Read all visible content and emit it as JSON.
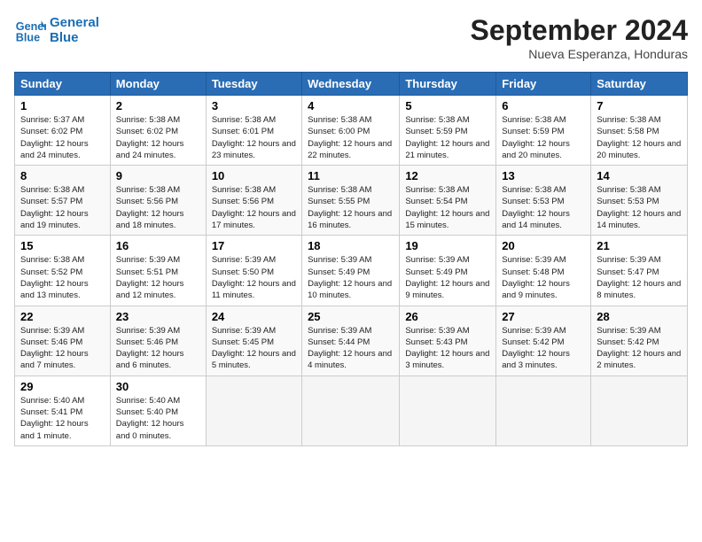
{
  "header": {
    "logo_line1": "General",
    "logo_line2": "Blue",
    "month": "September 2024",
    "location": "Nueva Esperanza, Honduras"
  },
  "columns": [
    "Sunday",
    "Monday",
    "Tuesday",
    "Wednesday",
    "Thursday",
    "Friday",
    "Saturday"
  ],
  "weeks": [
    [
      {
        "day": "1",
        "sunrise": "5:37 AM",
        "sunset": "6:02 PM",
        "daylight": "12 hours and 24 minutes."
      },
      {
        "day": "2",
        "sunrise": "5:38 AM",
        "sunset": "6:02 PM",
        "daylight": "12 hours and 24 minutes."
      },
      {
        "day": "3",
        "sunrise": "5:38 AM",
        "sunset": "6:01 PM",
        "daylight": "12 hours and 23 minutes."
      },
      {
        "day": "4",
        "sunrise": "5:38 AM",
        "sunset": "6:00 PM",
        "daylight": "12 hours and 22 minutes."
      },
      {
        "day": "5",
        "sunrise": "5:38 AM",
        "sunset": "5:59 PM",
        "daylight": "12 hours and 21 minutes."
      },
      {
        "day": "6",
        "sunrise": "5:38 AM",
        "sunset": "5:59 PM",
        "daylight": "12 hours and 20 minutes."
      },
      {
        "day": "7",
        "sunrise": "5:38 AM",
        "sunset": "5:58 PM",
        "daylight": "12 hours and 20 minutes."
      }
    ],
    [
      {
        "day": "8",
        "sunrise": "5:38 AM",
        "sunset": "5:57 PM",
        "daylight": "12 hours and 19 minutes."
      },
      {
        "day": "9",
        "sunrise": "5:38 AM",
        "sunset": "5:56 PM",
        "daylight": "12 hours and 18 minutes."
      },
      {
        "day": "10",
        "sunrise": "5:38 AM",
        "sunset": "5:56 PM",
        "daylight": "12 hours and 17 minutes."
      },
      {
        "day": "11",
        "sunrise": "5:38 AM",
        "sunset": "5:55 PM",
        "daylight": "12 hours and 16 minutes."
      },
      {
        "day": "12",
        "sunrise": "5:38 AM",
        "sunset": "5:54 PM",
        "daylight": "12 hours and 15 minutes."
      },
      {
        "day": "13",
        "sunrise": "5:38 AM",
        "sunset": "5:53 PM",
        "daylight": "12 hours and 14 minutes."
      },
      {
        "day": "14",
        "sunrise": "5:38 AM",
        "sunset": "5:53 PM",
        "daylight": "12 hours and 14 minutes."
      }
    ],
    [
      {
        "day": "15",
        "sunrise": "5:38 AM",
        "sunset": "5:52 PM",
        "daylight": "12 hours and 13 minutes."
      },
      {
        "day": "16",
        "sunrise": "5:39 AM",
        "sunset": "5:51 PM",
        "daylight": "12 hours and 12 minutes."
      },
      {
        "day": "17",
        "sunrise": "5:39 AM",
        "sunset": "5:50 PM",
        "daylight": "12 hours and 11 minutes."
      },
      {
        "day": "18",
        "sunrise": "5:39 AM",
        "sunset": "5:49 PM",
        "daylight": "12 hours and 10 minutes."
      },
      {
        "day": "19",
        "sunrise": "5:39 AM",
        "sunset": "5:49 PM",
        "daylight": "12 hours and 9 minutes."
      },
      {
        "day": "20",
        "sunrise": "5:39 AM",
        "sunset": "5:48 PM",
        "daylight": "12 hours and 9 minutes."
      },
      {
        "day": "21",
        "sunrise": "5:39 AM",
        "sunset": "5:47 PM",
        "daylight": "12 hours and 8 minutes."
      }
    ],
    [
      {
        "day": "22",
        "sunrise": "5:39 AM",
        "sunset": "5:46 PM",
        "daylight": "12 hours and 7 minutes."
      },
      {
        "day": "23",
        "sunrise": "5:39 AM",
        "sunset": "5:46 PM",
        "daylight": "12 hours and 6 minutes."
      },
      {
        "day": "24",
        "sunrise": "5:39 AM",
        "sunset": "5:45 PM",
        "daylight": "12 hours and 5 minutes."
      },
      {
        "day": "25",
        "sunrise": "5:39 AM",
        "sunset": "5:44 PM",
        "daylight": "12 hours and 4 minutes."
      },
      {
        "day": "26",
        "sunrise": "5:39 AM",
        "sunset": "5:43 PM",
        "daylight": "12 hours and 3 minutes."
      },
      {
        "day": "27",
        "sunrise": "5:39 AM",
        "sunset": "5:42 PM",
        "daylight": "12 hours and 3 minutes."
      },
      {
        "day": "28",
        "sunrise": "5:39 AM",
        "sunset": "5:42 PM",
        "daylight": "12 hours and 2 minutes."
      }
    ],
    [
      {
        "day": "29",
        "sunrise": "5:40 AM",
        "sunset": "5:41 PM",
        "daylight": "12 hours and 1 minute."
      },
      {
        "day": "30",
        "sunrise": "5:40 AM",
        "sunset": "5:40 PM",
        "daylight": "12 hours and 0 minutes."
      },
      null,
      null,
      null,
      null,
      null
    ]
  ]
}
